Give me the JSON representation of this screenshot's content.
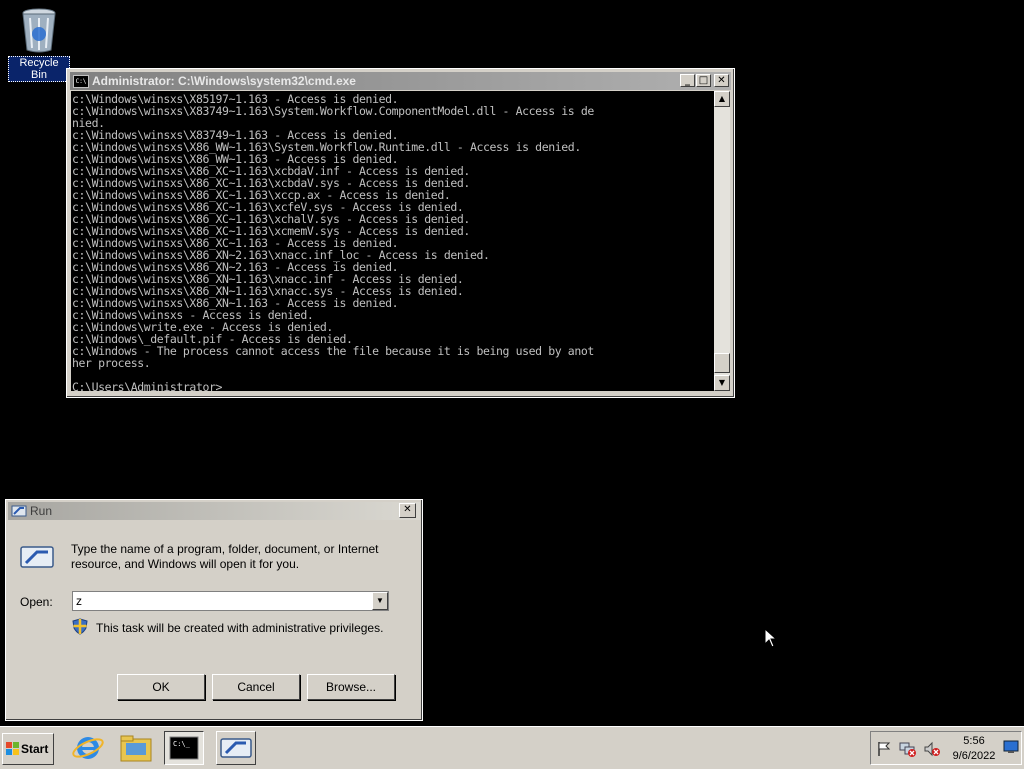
{
  "desktop": {
    "recycle_bin_label": "Recycle Bin"
  },
  "cmd_window": {
    "title": "Administrator: C:\\Windows\\system32\\cmd.exe",
    "icon_text": "C:\\",
    "minimize": "_",
    "maximize": "□",
    "close": "✕",
    "lines": [
      "c:\\Windows\\winsxs\\X85197~1.163 - Access is denied.",
      "c:\\Windows\\winsxs\\X83749~1.163\\System.Workflow.ComponentModel.dll - Access is de",
      "nied.",
      "c:\\Windows\\winsxs\\X83749~1.163 - Access is denied.",
      "c:\\Windows\\winsxs\\X86_WW~1.163\\System.Workflow.Runtime.dll - Access is denied.",
      "c:\\Windows\\winsxs\\X86_WW~1.163 - Access is denied.",
      "c:\\Windows\\winsxs\\X86_XC~1.163\\xcbdaV.inf - Access is denied.",
      "c:\\Windows\\winsxs\\X86_XC~1.163\\xcbdaV.sys - Access is denied.",
      "c:\\Windows\\winsxs\\X86_XC~1.163\\xccp.ax - Access is denied.",
      "c:\\Windows\\winsxs\\X86_XC~1.163\\xcfeV.sys - Access is denied.",
      "c:\\Windows\\winsxs\\X86_XC~1.163\\xchalV.sys - Access is denied.",
      "c:\\Windows\\winsxs\\X86_XC~1.163\\xcmemV.sys - Access is denied.",
      "c:\\Windows\\winsxs\\X86_XC~1.163 - Access is denied.",
      "c:\\Windows\\winsxs\\X86_XN~2.163\\xnacc.inf_loc - Access is denied.",
      "c:\\Windows\\winsxs\\X86_XN~2.163 - Access is denied.",
      "c:\\Windows\\winsxs\\X86_XN~1.163\\xnacc.inf - Access is denied.",
      "c:\\Windows\\winsxs\\X86_XN~1.163\\xnacc.sys - Access is denied.",
      "c:\\Windows\\winsxs\\X86_XN~1.163 - Access is denied.",
      "c:\\Windows\\winsxs - Access is denied.",
      "c:\\Windows\\write.exe - Access is denied.",
      "c:\\Windows\\_default.pif - Access is denied.",
      "c:\\Windows - The process cannot access the file because it is being used by anot",
      "her process.",
      "",
      "C:\\Users\\Administrator>"
    ]
  },
  "run_dialog": {
    "title": "Run",
    "close": "✕",
    "description": "Type the name of a program, folder, document, or Internet resource, and Windows will open it for you.",
    "open_label": "Open:",
    "open_value": "z",
    "admin_note": "This task will be created with administrative privileges.",
    "ok_label": "OK",
    "cancel_label": "Cancel",
    "browse_label": "Browse..."
  },
  "taskbar": {
    "start_label": "Start",
    "clock_time": "5:56",
    "clock_date": "9/6/2022"
  }
}
